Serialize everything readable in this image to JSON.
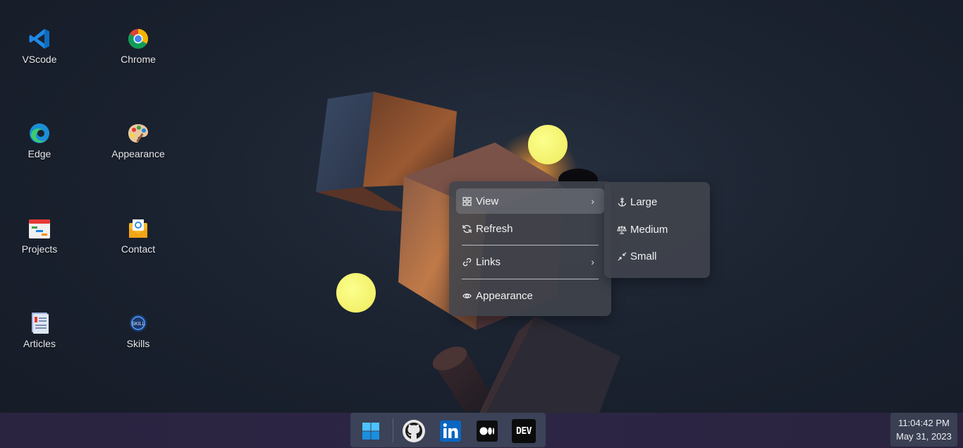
{
  "desktop": {
    "icons": [
      {
        "label": "VScode",
        "icon": "vscode-icon"
      },
      {
        "label": "Chrome",
        "icon": "chrome-icon"
      },
      {
        "label": "Edge",
        "icon": "edge-icon"
      },
      {
        "label": "Appearance",
        "icon": "palette-icon"
      },
      {
        "label": "Projects",
        "icon": "calendar-icon"
      },
      {
        "label": "Contact",
        "icon": "mail-envelope-icon"
      },
      {
        "label": "Articles",
        "icon": "document-icon"
      },
      {
        "label": "Skills",
        "icon": "skills-icon"
      }
    ]
  },
  "context_menu": {
    "items": [
      {
        "label": "View",
        "icon": "grid-icon",
        "has_submenu": true
      },
      {
        "label": "Refresh",
        "icon": "refresh-icon",
        "has_submenu": false
      },
      {
        "label": "Links",
        "icon": "link-icon",
        "has_submenu": true
      },
      {
        "label": "Appearance",
        "icon": "eye-icon",
        "has_submenu": false
      }
    ]
  },
  "view_submenu": {
    "items": [
      {
        "label": "Large",
        "icon": "anchor-icon"
      },
      {
        "label": "Medium",
        "icon": "scale-icon"
      },
      {
        "label": "Small",
        "icon": "minimize-arrows-icon"
      }
    ]
  },
  "taskbar": {
    "dock": [
      {
        "icon": "windows-start-icon"
      },
      {
        "icon": "github-icon"
      },
      {
        "icon": "linkedin-icon"
      },
      {
        "icon": "medium-icon"
      },
      {
        "icon": "dev-icon",
        "text": "DEV"
      }
    ],
    "clock": {
      "time": "11:04:42 PM",
      "date": "May 31, 2023"
    }
  },
  "colors": {
    "accent_yellow": "#f6f46c",
    "dock_bg": "#3c4257",
    "taskbar_bg": "#2b2542"
  }
}
